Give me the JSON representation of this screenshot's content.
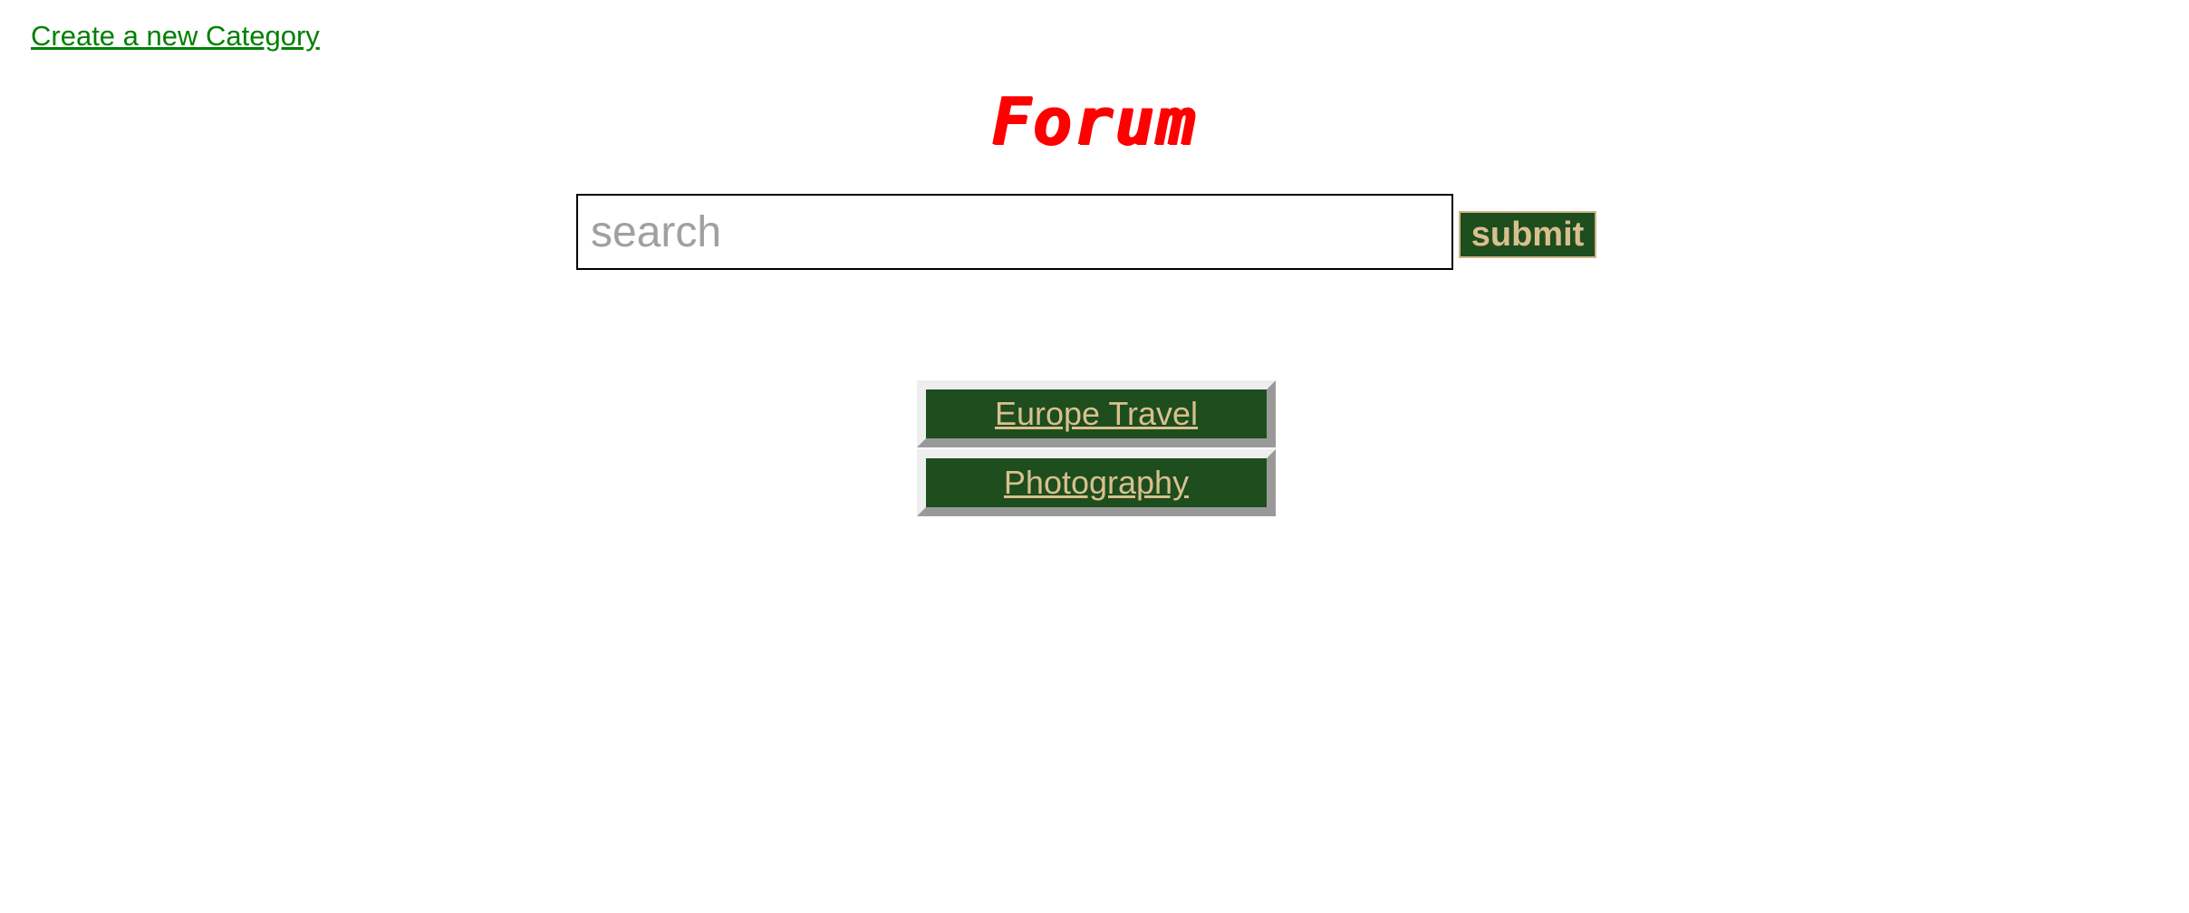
{
  "header": {
    "create_link": "Create a new Category",
    "title": "Forum"
  },
  "search": {
    "placeholder": "search",
    "value": "",
    "submit_label": "submit"
  },
  "categories": [
    {
      "label": "Europe Travel"
    },
    {
      "label": "Photography"
    }
  ],
  "colors": {
    "link": "#008000",
    "title": "#ff0000",
    "button_bg": "#1e4d1e",
    "button_text": "#d8c08e",
    "button_border": "#d2b48c"
  }
}
